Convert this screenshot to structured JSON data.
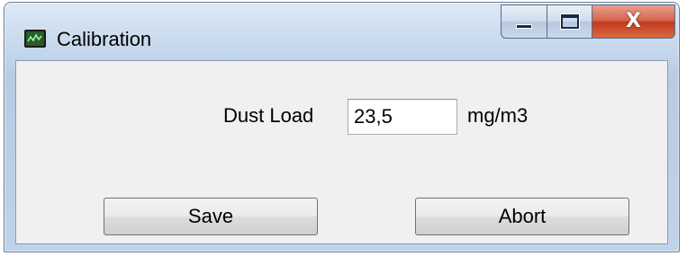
{
  "window": {
    "title": "Calibration",
    "icon": "chart-monitor-icon",
    "caption_buttons": {
      "minimize_icon": "minimize-icon",
      "maximize_icon": "maximize-icon",
      "close_glyph": "X"
    }
  },
  "form": {
    "label": "Dust Load",
    "value": "23,5",
    "unit": "mg/m3"
  },
  "buttons": {
    "save_label": "Save",
    "abort_label": "Abort"
  },
  "colors": {
    "frame": "#bfd3ea",
    "client": "#f0f0f0",
    "close": "#c23a1c"
  }
}
